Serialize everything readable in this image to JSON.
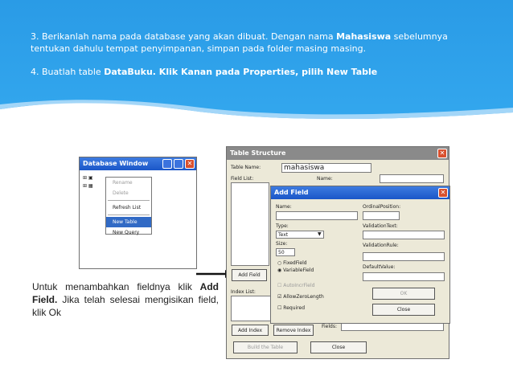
{
  "slide": {
    "step3_pre": "3. Berikanlah nama pada database yang akan dibuat. Dengan nama ",
    "step3_bold": "Mahasiswa",
    "step3_post": " sebelumnya tentukan dahulu   tempat penyimpanan, simpan pada folder masing masing.",
    "step4_pre": "4. Buatlah table ",
    "step4_bold": "DataBuku. Klik Kanan pada Properties, pilih New Table",
    "caption_pre": "Untuk menambahkan fieldnya klik ",
    "caption_bold": "Add Field.",
    "caption_post": " Jika telah selesai mengisikan field, klik Ok"
  },
  "database_window": {
    "title": "Database Window",
    "context_menu": [
      "Rename",
      "Delete",
      "Refresh List",
      "New Table",
      "New Query"
    ],
    "selected": "New Table"
  },
  "table_structure": {
    "title": "Table Structure",
    "table_name_label": "Table Name:",
    "table_name_value": "mahasiswa",
    "field_list_label": "Field List:",
    "name_label": "Name:",
    "add_field_btn": "Add Field",
    "index_list_label": "Index List:",
    "fields_label": "Fields:",
    "add_index_btn": "Add Index",
    "remove_index_btn": "Remove Index",
    "build_table_btn": "Build the Table",
    "close_btn": "Close"
  },
  "add_field": {
    "title": "Add Field",
    "name_label": "Name:",
    "ordinal_label": "OrdinalPosition:",
    "type_label": "Type:",
    "type_value": "Text",
    "validation_text_label": "ValidationText:",
    "size_label": "Size:",
    "size_value": "50",
    "validation_rule_label": "ValidationRule:",
    "fixed_field": "FixedField",
    "variable_field": "VariableField",
    "default_value_label": "DefaultValue:",
    "autoincr": "AutoIncrField",
    "allow_zero": "AllowZeroLength",
    "required": "Required",
    "ok_btn": "OK",
    "close_btn": "Close"
  },
  "colors": {
    "banner": "#2a9be6",
    "titlebar": "#1b56c8"
  }
}
